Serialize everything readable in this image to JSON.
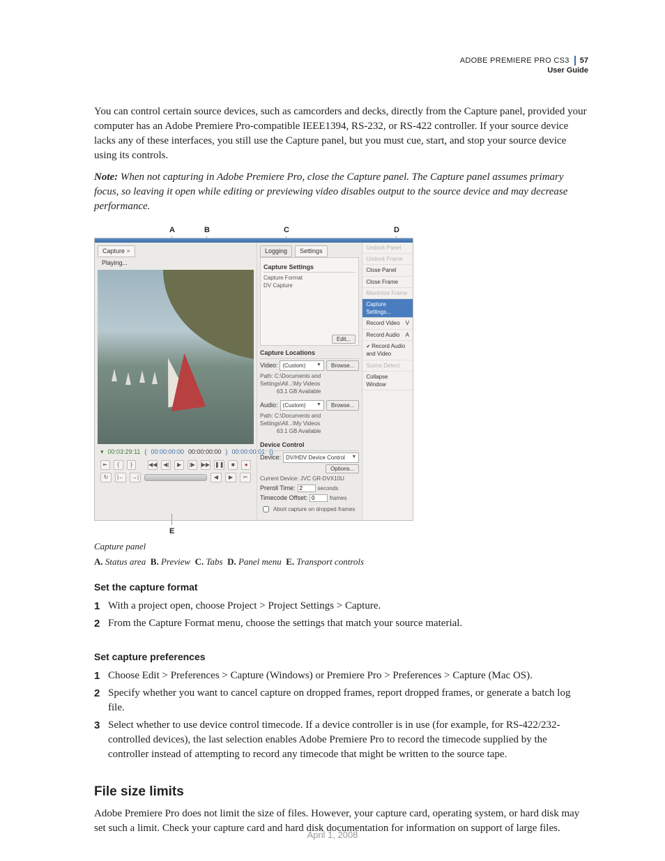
{
  "header": {
    "product": "ADOBE PREMIERE PRO CS3",
    "guide": "User Guide",
    "page_num": "57"
  },
  "paragraphs": {
    "intro": "You can control certain source devices, such as camcorders and decks, directly from the Capture panel, provided your computer has an Adobe Premiere Pro-compatible IEEE1394, RS-232, or RS-422 controller. If your source device lacks any of these interfaces, you still use the Capture panel, but you must cue, start, and stop your source device using its controls.",
    "note_label": "Note:",
    "note": "When not capturing in Adobe Premiere Pro, close the Capture panel. The Capture panel assumes primary focus, so leaving it open while editing or previewing video disables output to the source device and may decrease performance."
  },
  "callouts_top": {
    "A": "A",
    "B": "B",
    "C": "C",
    "D": "D"
  },
  "callout_bottom": {
    "E": "E"
  },
  "figure": {
    "tab_capture": "Capture",
    "status": "Playing...",
    "tabs": {
      "logging": "Logging",
      "settings": "Settings"
    },
    "settings_header": "Capture Settings",
    "capture_format_label": "Capture Format",
    "capture_format_value": "DV Capture",
    "edit_btn": "Edit...",
    "locations_header": "Capture Locations",
    "video_label": "Video:",
    "audio_label": "Audio:",
    "custom": "(Custom)",
    "browse": "Browse...",
    "path_video": "Path: C:\\Documents and Settings\\All...\\My Videos",
    "path_audio": "Path: C:\\Documents and Settings\\All...\\My Videos",
    "avail": "63.1 GB Available",
    "devctl_header": "Device Control",
    "device_label": "Device:",
    "device_value": "DV/HDV Device Control",
    "options_btn": "Options...",
    "current_device": "Current Device: JVC GR-DVX10U",
    "preroll_label": "Preroll Time:",
    "preroll_val": "2",
    "preroll_unit": "seconds",
    "tcoffset_label": "Timecode Offset:",
    "tcoffset_val": "0",
    "tcoffset_unit": "frames",
    "abort_label": "Abort capture on dropped frames",
    "tc1": "00:03:29:11",
    "tc2": "00:00:00:00",
    "tc3": "00:00:00:00",
    "tc4": "00:00:00:01",
    "menu": {
      "undock_panel": "Undock Panel",
      "undock_frame": "Undock Frame",
      "close_panel": "Close Panel",
      "close_frame": "Close Frame",
      "maximize": "Maximize Frame",
      "cap_settings": "Capture Settings...",
      "rec_video": "Record Video",
      "rec_video_sc": "V",
      "rec_audio": "Record Audio",
      "rec_audio_sc": "A",
      "rec_av": "Record Audio and Video",
      "scene_detect": "Scene Detect",
      "collapse": "Collapse Window"
    }
  },
  "caption": "Capture panel",
  "legend": {
    "A": "A.",
    "A_text": "Status area",
    "B": "B.",
    "B_text": "Preview",
    "C": "C.",
    "C_text": "Tabs",
    "D": "D.",
    "D_text": "Panel menu",
    "E": "E.",
    "E_text": "Transport controls"
  },
  "set_format": {
    "heading": "Set the capture format",
    "s1": "With a project open, choose Project > Project Settings > Capture.",
    "s2": "From the Capture Format menu, choose the settings that match your source material."
  },
  "set_prefs": {
    "heading": "Set capture preferences",
    "s1": "Choose Edit > Preferences > Capture (Windows) or Premiere Pro > Preferences > Capture (Mac OS).",
    "s2": "Specify whether you want to cancel capture on dropped frames, report dropped frames, or generate a batch log file.",
    "s3": "Select whether to use device control timecode. If a device controller is in use (for example, for RS-422/232-controlled devices), the last selection enables Adobe Premiere Pro to record the timecode supplied by the controller instead of attempting to record any timecode that might be written to the source tape."
  },
  "file_size": {
    "heading": "File size limits",
    "body": "Adobe Premiere Pro does not limit the size of files. However, your capture card, operating system, or hard disk may set such a limit. Check your capture card and hard disk documentation for information on support of large files."
  },
  "footer_date": "April 1, 2008",
  "nums": {
    "n1": "1",
    "n2": "2",
    "n3": "3"
  }
}
